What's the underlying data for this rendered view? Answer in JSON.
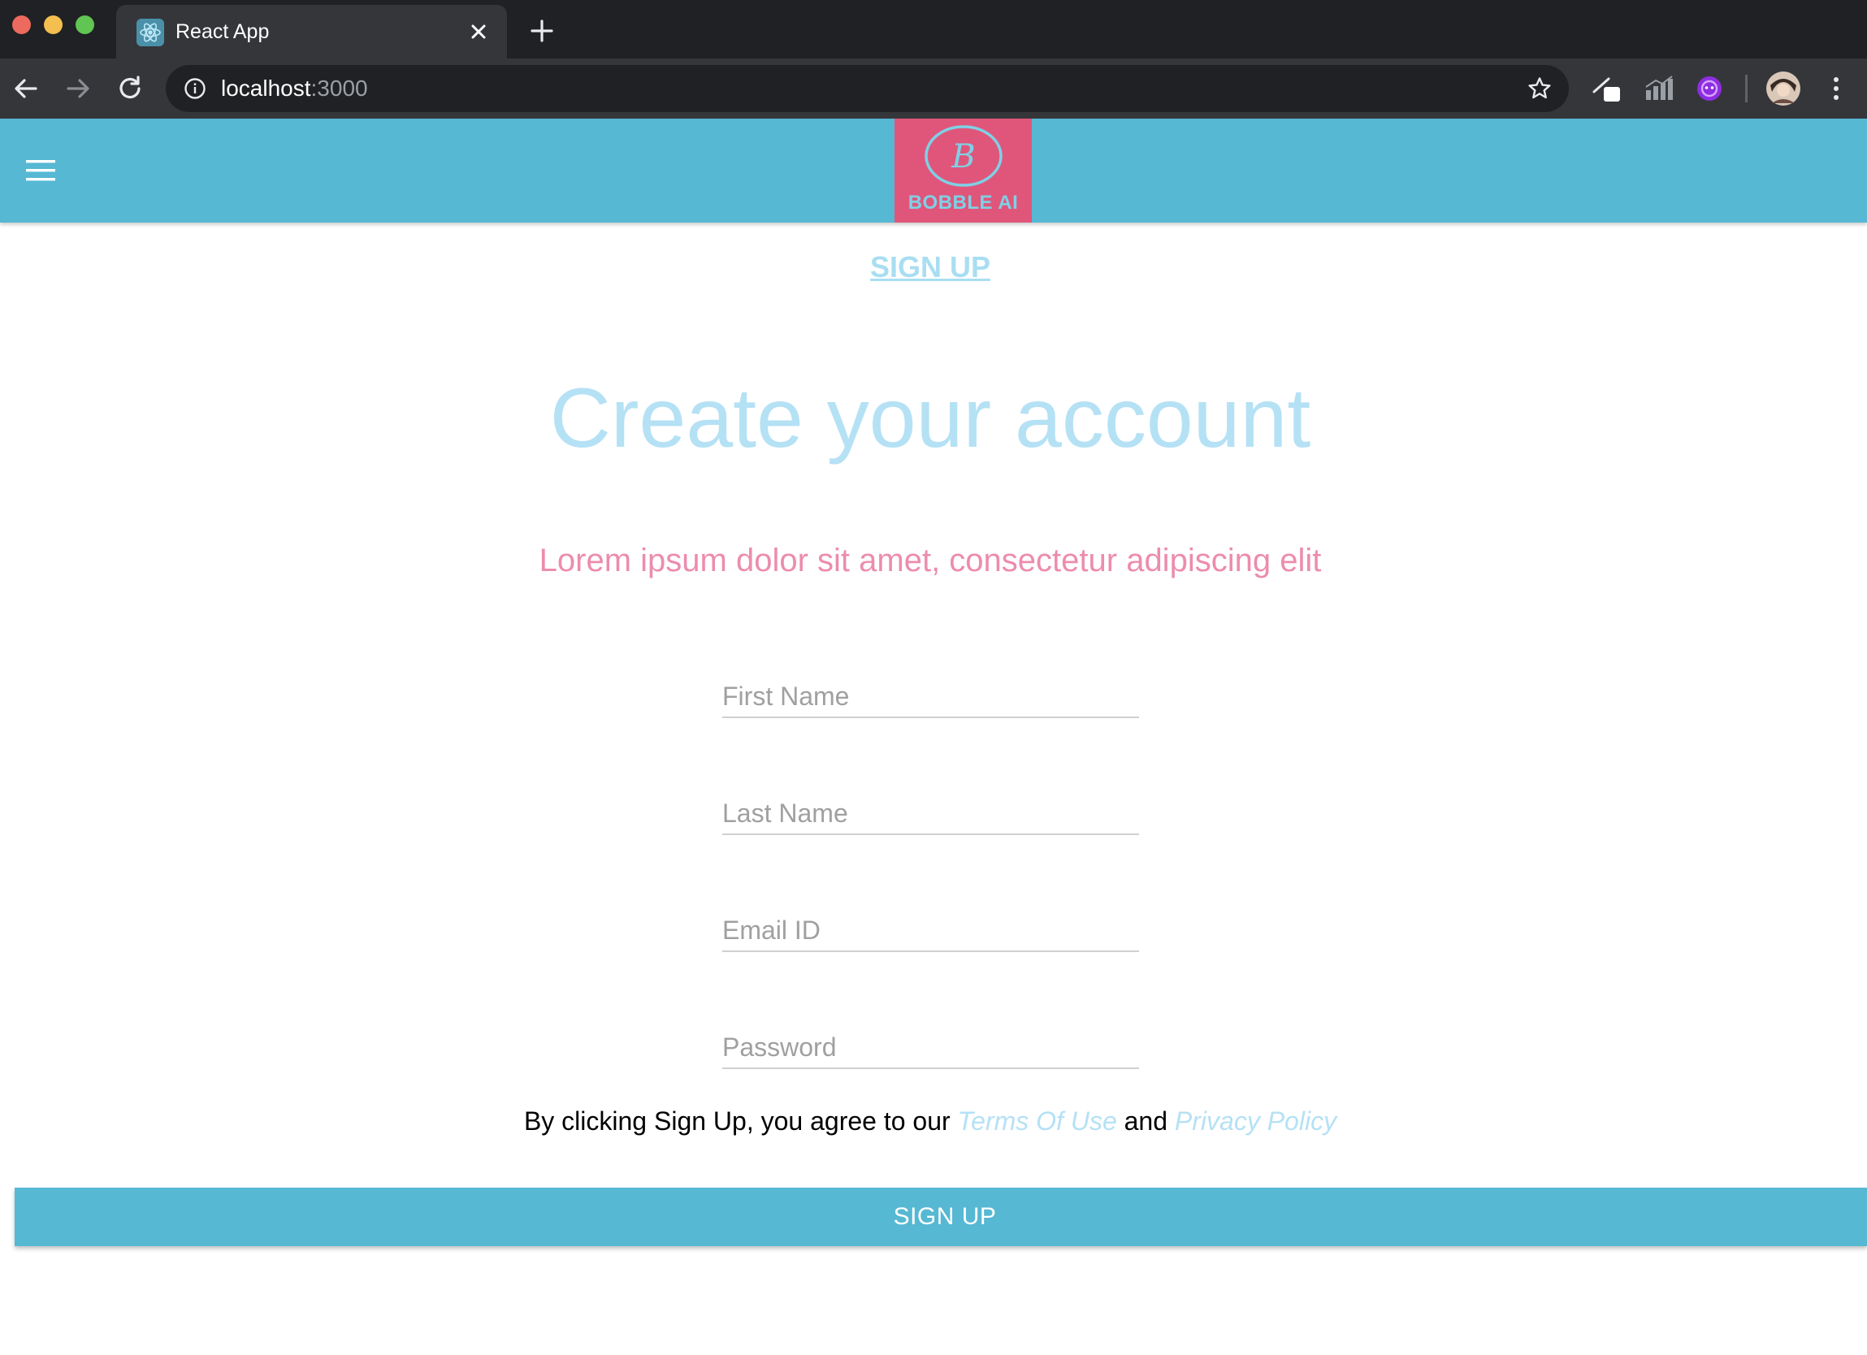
{
  "browser": {
    "tab_title": "React App",
    "url_host": "localhost",
    "url_port": ":3000"
  },
  "header": {
    "logo_text": "BOBBLE AI",
    "logo_letter": "B"
  },
  "main": {
    "signup_link": "SIGN UP",
    "heading": "Create your account",
    "subheading": "Lorem ipsum dolor sit amet, consectetur adipiscing elit",
    "fields": {
      "first_name_placeholder": "First Name",
      "last_name_placeholder": "Last Name",
      "email_placeholder": "Email ID",
      "password_placeholder": "Password"
    },
    "terms": {
      "prefix": "By clicking Sign Up, you agree to our",
      "terms_link": "Terms Of Use",
      "and": "and",
      "privacy_link": "Privacy Policy"
    },
    "submit_label": "SIGN UP"
  },
  "colors": {
    "brand": "#56b8d3",
    "logo_bg": "#e0567a",
    "heading": "#b5e1f5",
    "subheading": "#ec8cae"
  }
}
